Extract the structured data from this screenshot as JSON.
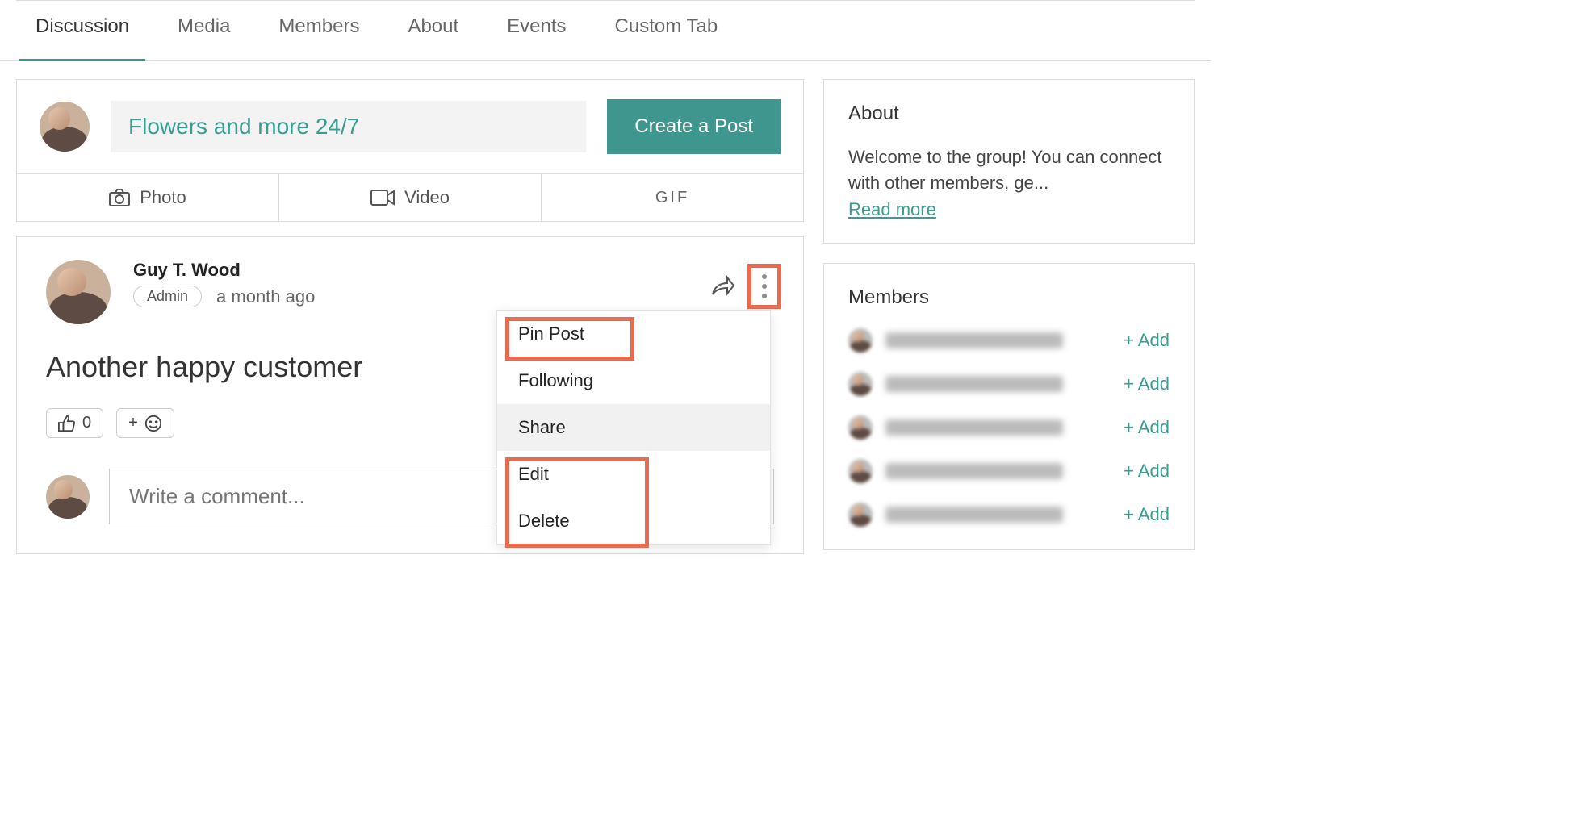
{
  "tabs": [
    {
      "label": "Discussion",
      "active": true
    },
    {
      "label": "Media"
    },
    {
      "label": "Members"
    },
    {
      "label": "About"
    },
    {
      "label": "Events"
    },
    {
      "label": "Custom Tab"
    }
  ],
  "compose": {
    "placeholder": "Flowers and more 24/7",
    "create_label": "Create a Post",
    "options": {
      "photo": "Photo",
      "video": "Video",
      "gif": "GIF"
    }
  },
  "post": {
    "author": "Guy T. Wood",
    "badge": "Admin",
    "timestamp": "a month ago",
    "body": "Another happy customer",
    "like_count": "0",
    "add_reaction": "+",
    "comment_placeholder": "Write a comment...",
    "menu": {
      "pin": "Pin Post",
      "following": "Following",
      "share": "Share",
      "edit": "Edit",
      "delete": "Delete"
    }
  },
  "sidebar": {
    "about_title": "About",
    "about_text": "Welcome to the group! You can connect with other members, ge...",
    "read_more": "Read more",
    "members_title": "Members",
    "add_label": "+ Add",
    "member_count": 5
  }
}
